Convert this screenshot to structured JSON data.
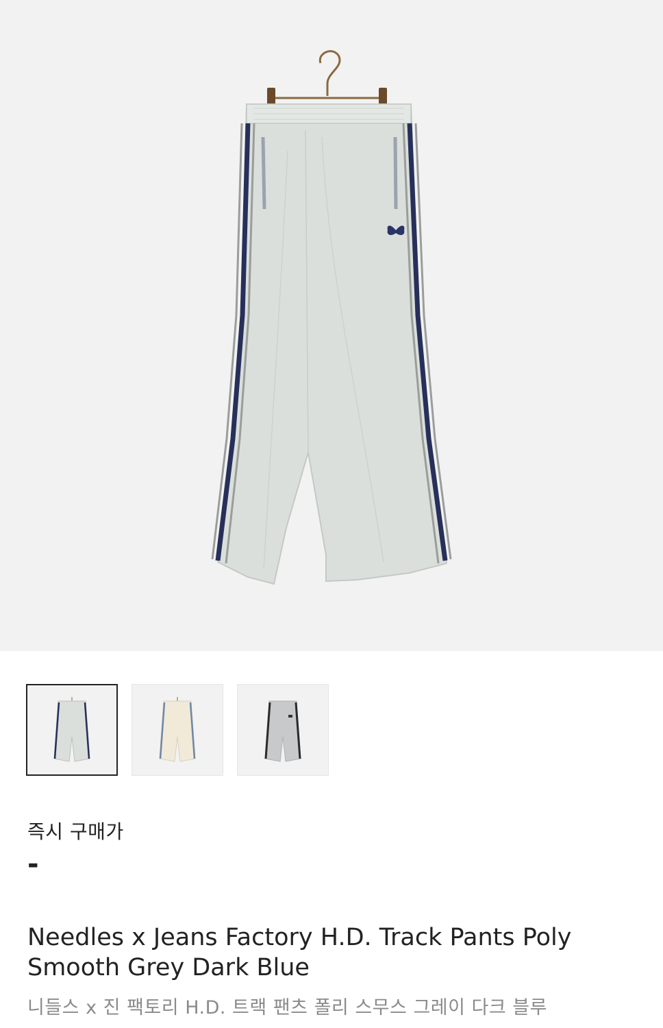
{
  "product": {
    "price_label": "즉시 구매가",
    "price_value": "-",
    "title_en": "Needles x Jeans Factory H.D. Track Pants Poly Smooth Grey Dark Blue",
    "title_ko": "니들스 x 진 팩토리 H.D. 트랙 팬츠 폴리 스무스 그레이 다크 블루"
  },
  "gallery": {
    "main_image": "pants-image",
    "thumbnails": [
      {
        "variant": "grey-dark-blue",
        "selected": true
      },
      {
        "variant": "ivory-blue",
        "selected": false
      },
      {
        "variant": "grey-black",
        "selected": false
      }
    ]
  },
  "colors": {
    "background_image": "#f2f2f2",
    "pants_grey": "#d9ddd9",
    "stripe_navy": "#26305a"
  }
}
